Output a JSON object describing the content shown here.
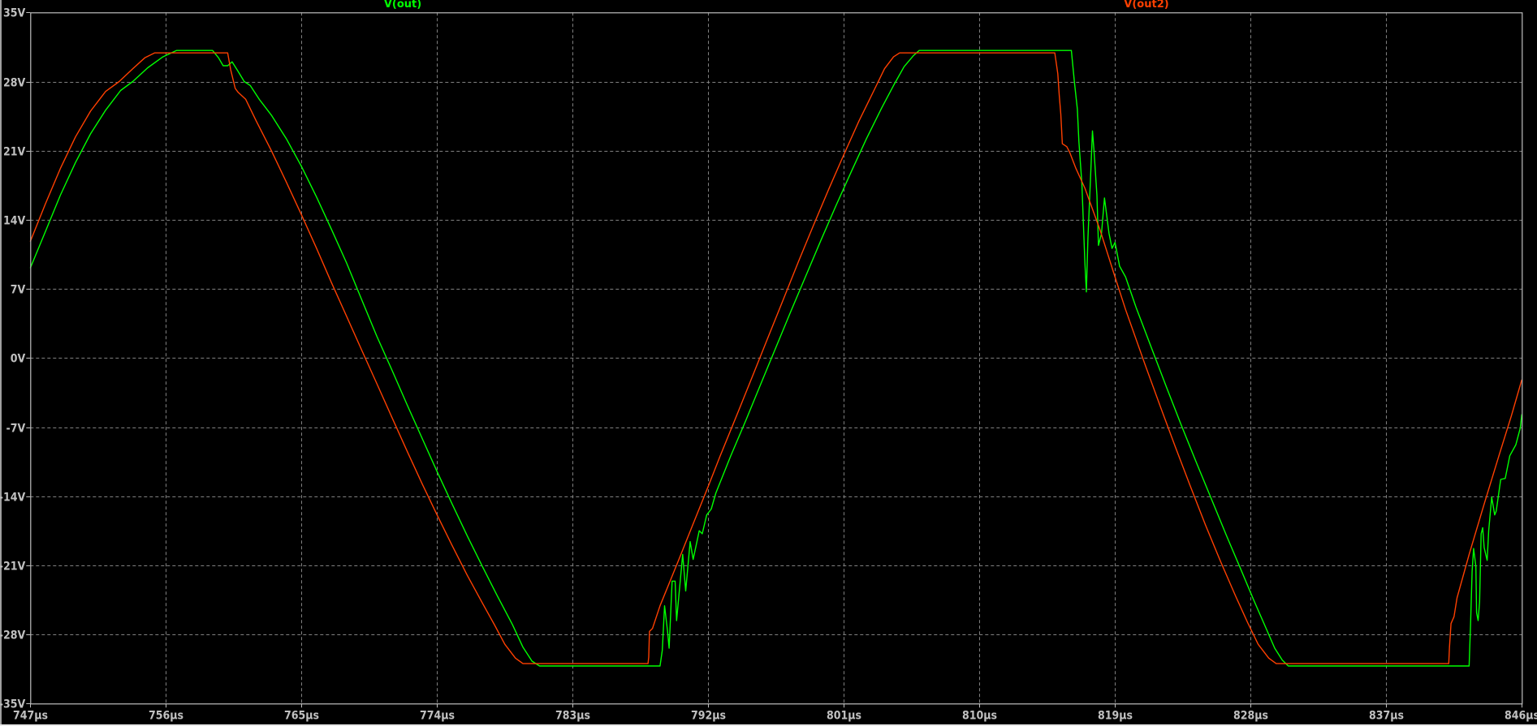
{
  "chart_data": {
    "type": "line",
    "title": "",
    "xlabel": "",
    "ylabel": "",
    "xlim": [
      747,
      846
    ],
    "ylim": [
      -35,
      35
    ],
    "grid": true,
    "legend_placement": "top",
    "x_ticks": [
      747,
      756,
      765,
      774,
      783,
      792,
      801,
      810,
      819,
      828,
      837,
      846
    ],
    "x_tick_labels": [
      "747µs",
      "756µs",
      "765µs",
      "774µs",
      "783µs",
      "792µs",
      "801µs",
      "810µs",
      "819µs",
      "828µs",
      "837µs",
      "846µs"
    ],
    "y_ticks": [
      35,
      28,
      21,
      14,
      7,
      0,
      -7,
      -14,
      -21,
      -28,
      -35
    ],
    "y_tick_labels": [
      "35V",
      "28V",
      "21V",
      "14V",
      "7V",
      "0V",
      "-7V",
      "-14V",
      "-21V",
      "-28V",
      "-35V"
    ],
    "background_color": "#000000",
    "grid_color": "#808080",
    "axis_color": "#c0c0c0",
    "series": [
      {
        "name": "V(out)",
        "color": "#00ff00",
        "points": [
          [
            747,
            9.1
          ],
          [
            748,
            12.8
          ],
          [
            749,
            16.5
          ],
          [
            750,
            19.8
          ],
          [
            751,
            22.7
          ],
          [
            752,
            25.1
          ],
          [
            753,
            27.1
          ],
          [
            753.8,
            28
          ],
          [
            754.8,
            29.4
          ],
          [
            755.8,
            30.5
          ],
          [
            756.7,
            31.15
          ],
          [
            759.1,
            31.15
          ],
          [
            759.5,
            30.4
          ],
          [
            759.8,
            29.6
          ],
          [
            760.1,
            29.6
          ],
          [
            760.4,
            30
          ],
          [
            760.8,
            29
          ],
          [
            761.2,
            28
          ],
          [
            761.6,
            27.6
          ],
          [
            762.2,
            26.2
          ],
          [
            763,
            24.6
          ],
          [
            764,
            22.2
          ],
          [
            765,
            19.4
          ],
          [
            766,
            16.3
          ],
          [
            767,
            13
          ],
          [
            768,
            9.6
          ],
          [
            769,
            5.9
          ],
          [
            770,
            2.2
          ],
          [
            771,
            -1.2
          ],
          [
            772,
            -4.7
          ],
          [
            773,
            -8.1
          ],
          [
            774,
            -11.5
          ],
          [
            775,
            -14.8
          ],
          [
            776,
            -18
          ],
          [
            777,
            -21.1
          ],
          [
            778,
            -24.1
          ],
          [
            779,
            -27
          ],
          [
            779.7,
            -29.3
          ],
          [
            780.3,
            -30.7
          ],
          [
            780.8,
            -31.2
          ],
          [
            788.8,
            -31.2
          ],
          [
            788.95,
            -29.6
          ],
          [
            789.1,
            -25.1
          ],
          [
            789.3,
            -27.7
          ],
          [
            789.4,
            -29.4
          ],
          [
            789.6,
            -22.6
          ],
          [
            789.8,
            -22.6
          ],
          [
            789.9,
            -26.6
          ],
          [
            790.3,
            -19.9
          ],
          [
            790.5,
            -23.6
          ],
          [
            790.8,
            -18.6
          ],
          [
            791.0,
            -20.4
          ],
          [
            791.4,
            -17.5
          ],
          [
            791.6,
            -17.8
          ],
          [
            791.9,
            -15.9
          ],
          [
            792.2,
            -15.3
          ],
          [
            792.5,
            -13.7
          ],
          [
            793.5,
            -9.9
          ],
          [
            794.5,
            -6.3
          ],
          [
            795.5,
            -2.6
          ],
          [
            796.5,
            1.1
          ],
          [
            797.5,
            4.8
          ],
          [
            798.5,
            8.4
          ],
          [
            799.5,
            12
          ],
          [
            800.5,
            15.5
          ],
          [
            801.5,
            18.9
          ],
          [
            802.5,
            22.2
          ],
          [
            803.5,
            25.3
          ],
          [
            804.3,
            27.6
          ],
          [
            805,
            29.5
          ],
          [
            805.6,
            30.6
          ],
          [
            806,
            31.15
          ],
          [
            816.1,
            31.15
          ],
          [
            816.3,
            28.0
          ],
          [
            816.5,
            25.2
          ],
          [
            816.6,
            21.9
          ],
          [
            816.8,
            17.6
          ],
          [
            816.9,
            13.7
          ],
          [
            817.0,
            9.6
          ],
          [
            817.1,
            6.7
          ],
          [
            817.2,
            12.1
          ],
          [
            817.4,
            19.2
          ],
          [
            817.5,
            23.0
          ],
          [
            817.6,
            21.1
          ],
          [
            817.8,
            16.5
          ],
          [
            817.9,
            11.4
          ],
          [
            818.1,
            12.6
          ],
          [
            818.3,
            16.2
          ],
          [
            818.6,
            12.6
          ],
          [
            818.8,
            11.1
          ],
          [
            819.0,
            11.7
          ],
          [
            819.3,
            9.3
          ],
          [
            819.7,
            8.2
          ],
          [
            820.4,
            5.1
          ],
          [
            821.4,
            1.1
          ],
          [
            822.4,
            -2.9
          ],
          [
            823.4,
            -6.8
          ],
          [
            824.4,
            -10.6
          ],
          [
            825.4,
            -14.3
          ],
          [
            826.4,
            -18
          ],
          [
            827.4,
            -21.6
          ],
          [
            828.2,
            -24.5
          ],
          [
            829,
            -27.3
          ],
          [
            829.6,
            -29.4
          ],
          [
            830.1,
            -30.6
          ],
          [
            830.5,
            -31.2
          ],
          [
            842.5,
            -31.2
          ],
          [
            842.6,
            -26.9
          ],
          [
            842.7,
            -21.6
          ],
          [
            842.8,
            -19.3
          ],
          [
            842.95,
            -21.1
          ],
          [
            843.0,
            -25.8
          ],
          [
            843.1,
            -26.6
          ],
          [
            843.2,
            -24.7
          ],
          [
            843.3,
            -17.8
          ],
          [
            843.4,
            -17.2
          ],
          [
            843.5,
            -19.2
          ],
          [
            843.7,
            -20.5
          ],
          [
            843.8,
            -17.5
          ],
          [
            844.0,
            -14.1
          ],
          [
            844.2,
            -15.9
          ],
          [
            844.3,
            -15.5
          ],
          [
            844.6,
            -12.3
          ],
          [
            844.9,
            -12.2
          ],
          [
            845.2,
            -9.9
          ],
          [
            845.6,
            -8.8
          ],
          [
            845.9,
            -7.1
          ],
          [
            846,
            -5.7
          ]
        ]
      },
      {
        "name": "V(out2)",
        "color": "#ff4000",
        "points": [
          [
            747,
            11.8
          ],
          [
            748,
            15.6
          ],
          [
            749,
            19.2
          ],
          [
            750,
            22.4
          ],
          [
            751,
            25
          ],
          [
            752,
            27
          ],
          [
            752.9,
            28
          ],
          [
            753.8,
            29.3
          ],
          [
            754.6,
            30.4
          ],
          [
            755.25,
            30.9
          ],
          [
            760.1,
            30.9
          ],
          [
            760.3,
            29.2
          ],
          [
            760.6,
            27.3
          ],
          [
            760.8,
            26.9
          ],
          [
            761.3,
            26.2
          ],
          [
            762,
            24
          ],
          [
            763,
            21
          ],
          [
            764,
            17.8
          ],
          [
            765,
            14.5
          ],
          [
            766,
            11.1
          ],
          [
            767,
            7.6
          ],
          [
            768,
            4.2
          ],
          [
            769,
            0.8
          ],
          [
            770,
            -2.6
          ],
          [
            771,
            -6
          ],
          [
            772,
            -9.4
          ],
          [
            773,
            -12.7
          ],
          [
            774,
            -15.9
          ],
          [
            775,
            -19
          ],
          [
            776,
            -22
          ],
          [
            777,
            -24.8
          ],
          [
            777.8,
            -27
          ],
          [
            778.5,
            -29
          ],
          [
            779.2,
            -30.4
          ],
          [
            779.7,
            -30.96
          ],
          [
            788.0,
            -30.96
          ],
          [
            788.05,
            -30.3
          ],
          [
            788.1,
            -27.7
          ],
          [
            788.3,
            -27.4
          ],
          [
            788.8,
            -25.1
          ],
          [
            790,
            -20.6
          ],
          [
            791,
            -16.8
          ],
          [
            792,
            -13
          ],
          [
            792.8,
            -9.9
          ],
          [
            794,
            -5.4
          ],
          [
            795,
            -1.6
          ],
          [
            796,
            2.2
          ],
          [
            797,
            6
          ],
          [
            798,
            9.8
          ],
          [
            799,
            13.5
          ],
          [
            800,
            17.1
          ],
          [
            801,
            20.6
          ],
          [
            802,
            24
          ],
          [
            803,
            27.1
          ],
          [
            803.7,
            29.3
          ],
          [
            804.3,
            30.5
          ],
          [
            804.7,
            30.9
          ],
          [
            815.0,
            30.9
          ],
          [
            815.2,
            28.8
          ],
          [
            815.3,
            26.6
          ],
          [
            815.4,
            24.7
          ],
          [
            815.5,
            21.7
          ],
          [
            815.8,
            21.4
          ],
          [
            816.0,
            20.8
          ],
          [
            816.4,
            19.2
          ],
          [
            817,
            17.2
          ],
          [
            818,
            13
          ],
          [
            819,
            8.2
          ],
          [
            819.7,
            4.9
          ],
          [
            820,
            3.6
          ],
          [
            821,
            -0.7
          ],
          [
            822,
            -4.9
          ],
          [
            823,
            -9
          ],
          [
            824,
            -13
          ],
          [
            825,
            -16.9
          ],
          [
            826,
            -20.6
          ],
          [
            827,
            -24.1
          ],
          [
            827.8,
            -26.8
          ],
          [
            828.5,
            -29
          ],
          [
            829.2,
            -30.4
          ],
          [
            829.7,
            -30.96
          ],
          [
            841.15,
            -30.96
          ],
          [
            841.2,
            -29.3
          ],
          [
            841.3,
            -26.9
          ],
          [
            841.5,
            -26.2
          ],
          [
            841.7,
            -24.3
          ],
          [
            842.5,
            -19.9
          ],
          [
            843.5,
            -14.8
          ],
          [
            844.5,
            -9.8
          ],
          [
            845.3,
            -5.9
          ],
          [
            846,
            -2.2
          ]
        ]
      }
    ]
  }
}
